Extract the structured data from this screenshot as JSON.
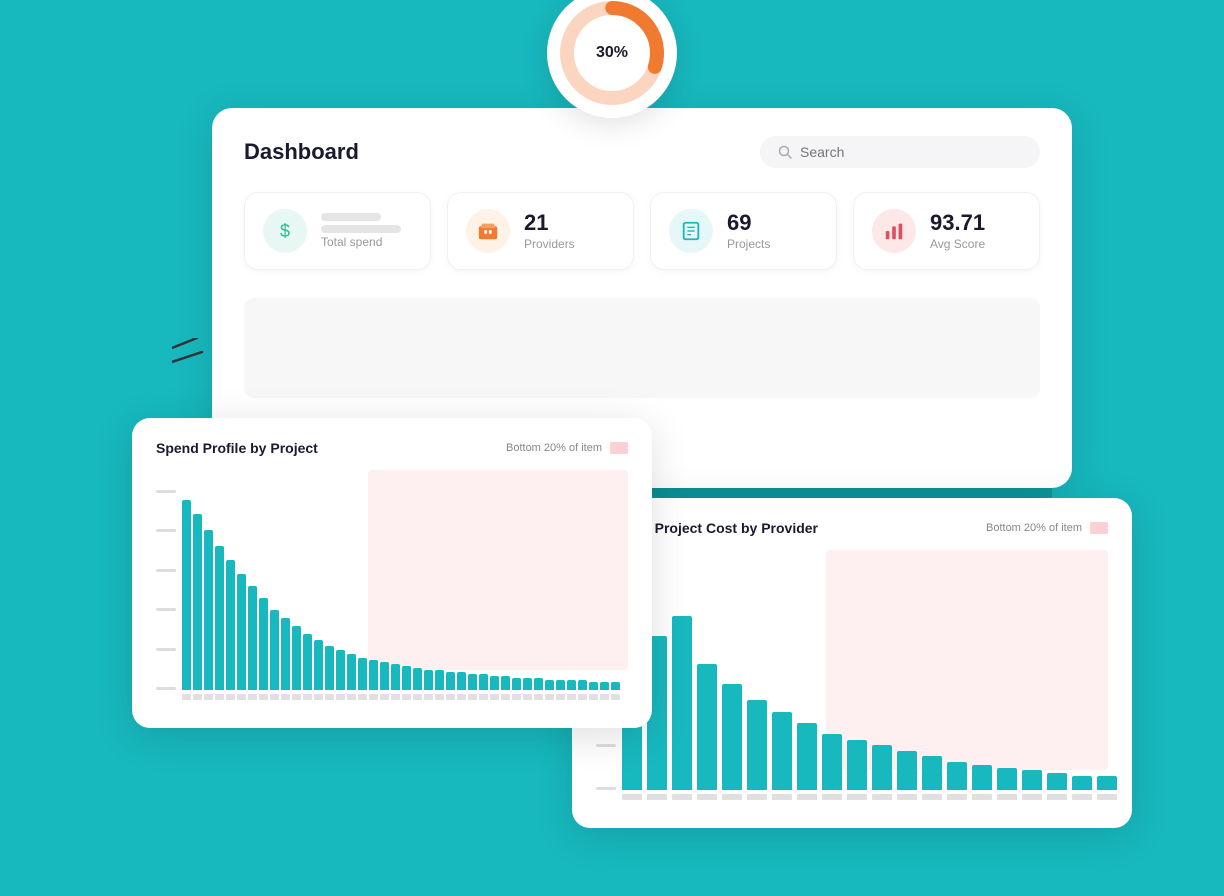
{
  "background": {
    "color": "#17b8be"
  },
  "donut": {
    "percentage": "30%",
    "value": 30,
    "color_filled": "#f07a30",
    "color_empty": "#fcd5c0"
  },
  "dashboard": {
    "title": "Dashboard",
    "search": {
      "placeholder": "Search"
    },
    "stats": [
      {
        "id": "total-spend",
        "icon": "$",
        "icon_style": "green",
        "label": "Total spend",
        "value": null,
        "has_placeholder": true
      },
      {
        "id": "providers",
        "icon": "🏢",
        "icon_style": "orange",
        "label": "Providers",
        "value": "21",
        "has_placeholder": false
      },
      {
        "id": "projects",
        "icon": "📋",
        "icon_style": "teal",
        "label": "Projects",
        "value": "69",
        "has_placeholder": false
      },
      {
        "id": "avg-score",
        "icon": "📊",
        "icon_style": "red",
        "label": "Avg Score",
        "value": "93.71",
        "has_placeholder": false
      }
    ]
  },
  "chart1": {
    "title": "Spend Profile by Project",
    "legend_label": "Bottom 20% of item",
    "bars": [
      95,
      88,
      80,
      72,
      65,
      58,
      52,
      46,
      40,
      36,
      32,
      28,
      25,
      22,
      20,
      18,
      16,
      15,
      14,
      13,
      12,
      11,
      10,
      10,
      9,
      9,
      8,
      8,
      7,
      7,
      6,
      6,
      6,
      5,
      5,
      5,
      5,
      4,
      4,
      4
    ]
  },
  "chart2": {
    "title": "Average Project Cost by Provider",
    "legend_label": "Bottom 20% of item",
    "bars": [
      75,
      55,
      62,
      45,
      38,
      32,
      28,
      24,
      20,
      18,
      16,
      14,
      12,
      10,
      9,
      8,
      7,
      6,
      5,
      5
    ]
  }
}
